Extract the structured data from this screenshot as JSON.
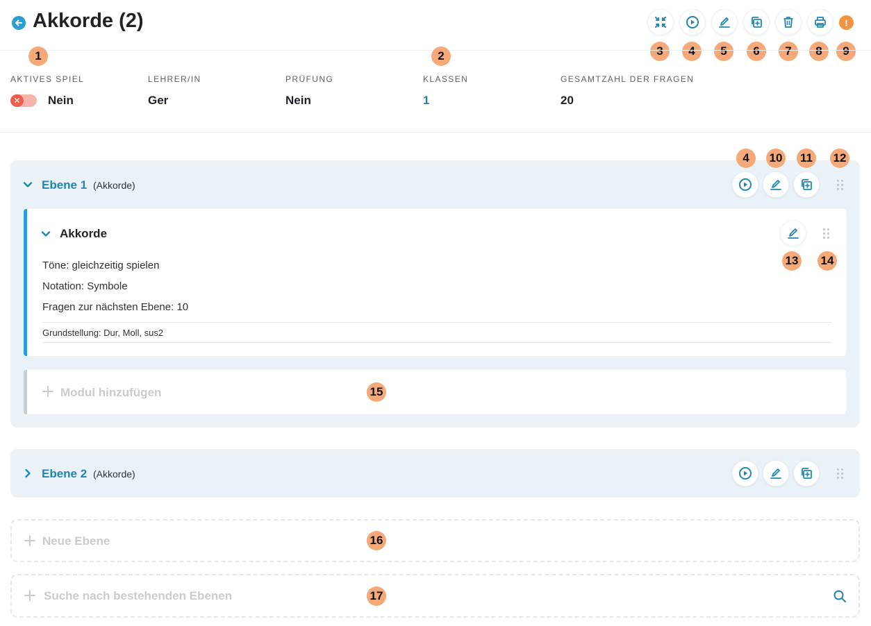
{
  "header": {
    "title": "Akkorde (2)",
    "back_icon": "arrow-left-icon",
    "toolbar": [
      {
        "name": "collapse-button",
        "icon": "collapse-icon",
        "badge": "3"
      },
      {
        "name": "play-button",
        "icon": "play-icon",
        "badge": "4"
      },
      {
        "name": "edit-button",
        "icon": "pencil-icon",
        "badge": "5"
      },
      {
        "name": "duplicate-button",
        "icon": "duplicate-icon",
        "badge": "6"
      },
      {
        "name": "delete-button",
        "icon": "trash-icon",
        "badge": "7"
      },
      {
        "name": "print-button",
        "icon": "printer-icon",
        "badge": "8"
      }
    ],
    "info_label": "!",
    "info_badge": "9"
  },
  "meta": {
    "active_game": {
      "label": "AKTIVES SPIEL",
      "value": "Nein",
      "badge": "1"
    },
    "teacher": {
      "label": "LEHRER/IN",
      "value": "Ger"
    },
    "exam": {
      "label": "PRÜFUNG",
      "value": "Nein"
    },
    "classes": {
      "label": "KLASSEN",
      "value": "1",
      "badge": "2"
    },
    "total_questions": {
      "label": "GESAMTZAHL DER FRAGEN",
      "value": "20"
    }
  },
  "levels": [
    {
      "title": "Ebene 1",
      "subtitle": "(Akkorde)",
      "expanded": true,
      "badges": {
        "play": "4",
        "edit": "10",
        "duplicate": "11",
        "drag": "12"
      },
      "module": {
        "title": "Akkorde",
        "lines": [
          "Töne: gleichzeitig spielen",
          "Notation: Symbole",
          "Fragen zur nächsten Ebene: 10"
        ],
        "detail": "Grundstellung: Dur, Moll, sus2",
        "badges": {
          "edit": "13",
          "drag": "14"
        }
      },
      "add_module": {
        "label": "Modul hinzufügen",
        "badge": "15"
      }
    },
    {
      "title": "Ebene 2",
      "subtitle": "(Akkorde)",
      "expanded": false
    }
  ],
  "new_level": {
    "label": "Neue Ebene",
    "badge": "16"
  },
  "search_levels": {
    "label": "Suche nach bestehenden Ebenen",
    "badge": "17"
  },
  "colors": {
    "accent": "#1f86b3",
    "badge": "#f6a978",
    "toggle_off": "#ee5f4f",
    "panel": "#eaf2f7"
  }
}
